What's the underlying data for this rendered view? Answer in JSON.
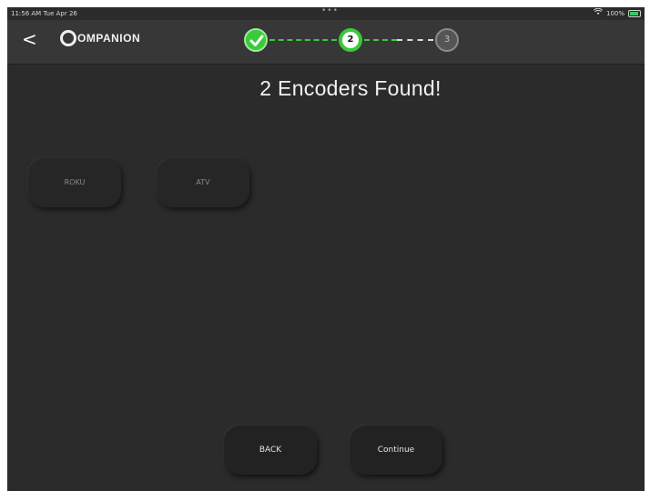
{
  "status_bar": {
    "time_date": "11:56 AM  Tue Apr 26",
    "dots": "•••",
    "battery_text": "100%",
    "wifi_icon": "wifi-icon",
    "battery_icon": "battery-icon"
  },
  "header": {
    "back_icon": "chevron-left-icon",
    "back_glyph": "<",
    "logo_text": "OMPANION",
    "stepper": {
      "steps": [
        {
          "label": "",
          "state": "complete"
        },
        {
          "label": "2",
          "state": "current"
        },
        {
          "label": "3",
          "state": "pending"
        }
      ],
      "accent_color": "#3cc93c",
      "pending_color": "#555555"
    }
  },
  "main": {
    "title": "2 Encoders Found!",
    "encoders": [
      {
        "label": "ROKU"
      },
      {
        "label": "ATV"
      }
    ]
  },
  "footer": {
    "back_label": "BACK",
    "continue_label": "Continue"
  },
  "colors": {
    "background": "#2b2b2b",
    "header": "#373737",
    "accent": "#3cc93c"
  }
}
